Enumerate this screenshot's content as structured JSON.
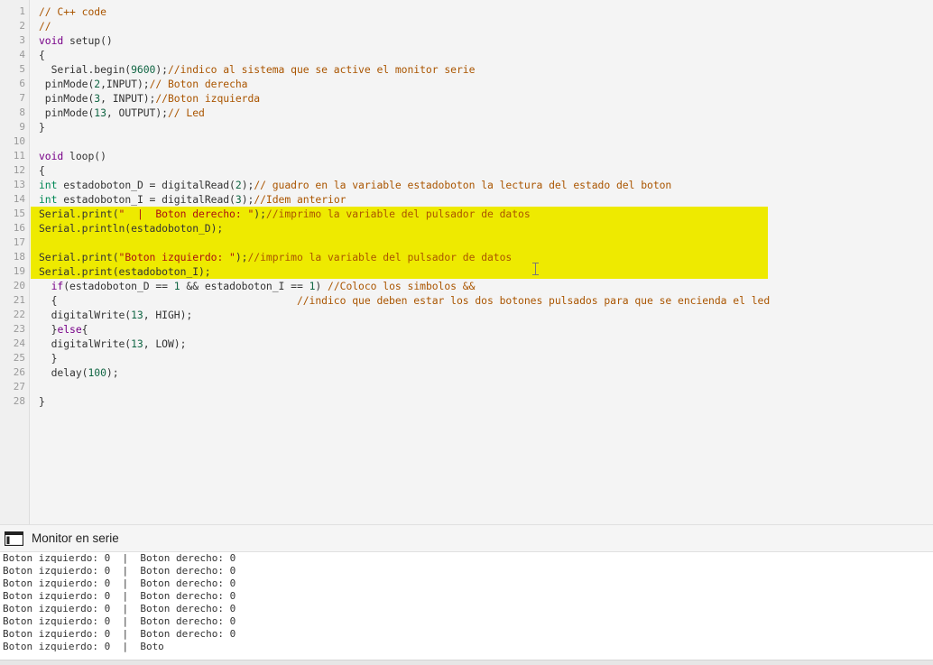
{
  "editor": {
    "highlight_color": "#eeea00",
    "lines": [
      {
        "n": "1",
        "hl": false,
        "tokens": [
          {
            "c": "comment",
            "t": "// C++ code"
          }
        ]
      },
      {
        "n": "2",
        "hl": false,
        "tokens": [
          {
            "c": "comment",
            "t": "//"
          }
        ]
      },
      {
        "n": "3",
        "hl": false,
        "tokens": [
          {
            "c": "kw",
            "t": "void"
          },
          {
            "c": "plain",
            "t": " setup()"
          }
        ]
      },
      {
        "n": "4",
        "hl": false,
        "tokens": [
          {
            "c": "plain",
            "t": "{"
          }
        ]
      },
      {
        "n": "5",
        "hl": false,
        "tokens": [
          {
            "c": "plain",
            "t": "  Serial.begin("
          },
          {
            "c": "num",
            "t": "9600"
          },
          {
            "c": "plain",
            "t": ");"
          },
          {
            "c": "comment",
            "t": "//indico al sistema que se active el monitor serie"
          }
        ]
      },
      {
        "n": "6",
        "hl": false,
        "tokens": [
          {
            "c": "plain",
            "t": " pinMode("
          },
          {
            "c": "num",
            "t": "2"
          },
          {
            "c": "plain",
            "t": ",INPUT);"
          },
          {
            "c": "comment",
            "t": "// Boton derecha"
          }
        ]
      },
      {
        "n": "7",
        "hl": false,
        "tokens": [
          {
            "c": "plain",
            "t": " pinMode("
          },
          {
            "c": "num",
            "t": "3"
          },
          {
            "c": "plain",
            "t": ", INPUT);"
          },
          {
            "c": "comment",
            "t": "//Boton izquierda"
          }
        ]
      },
      {
        "n": "8",
        "hl": false,
        "tokens": [
          {
            "c": "plain",
            "t": " pinMode("
          },
          {
            "c": "num",
            "t": "13"
          },
          {
            "c": "plain",
            "t": ", OUTPUT);"
          },
          {
            "c": "comment",
            "t": "// Led"
          }
        ]
      },
      {
        "n": "9",
        "hl": false,
        "tokens": [
          {
            "c": "plain",
            "t": "}"
          }
        ]
      },
      {
        "n": "10",
        "hl": false,
        "tokens": []
      },
      {
        "n": "11",
        "hl": false,
        "tokens": [
          {
            "c": "kw",
            "t": "void"
          },
          {
            "c": "plain",
            "t": " loop()"
          }
        ]
      },
      {
        "n": "12",
        "hl": false,
        "tokens": [
          {
            "c": "plain",
            "t": "{"
          }
        ]
      },
      {
        "n": "13",
        "hl": false,
        "tokens": [
          {
            "c": "type",
            "t": "int"
          },
          {
            "c": "plain",
            "t": " estadoboton_D = digitalRead("
          },
          {
            "c": "num",
            "t": "2"
          },
          {
            "c": "plain",
            "t": ");"
          },
          {
            "c": "comment",
            "t": "// guadro en la variable estadoboton la lectura del estado del boton"
          }
        ]
      },
      {
        "n": "14",
        "hl": false,
        "tokens": [
          {
            "c": "type",
            "t": "int"
          },
          {
            "c": "plain",
            "t": " estadoboton_I = digitalRead("
          },
          {
            "c": "num",
            "t": "3"
          },
          {
            "c": "plain",
            "t": ");"
          },
          {
            "c": "comment",
            "t": "//Idem anterior"
          }
        ]
      },
      {
        "n": "15",
        "hl": true,
        "tokens": [
          {
            "c": "plain",
            "t": "Serial.print("
          },
          {
            "c": "str",
            "t": "\"  |  Boton derecho: \""
          },
          {
            "c": "plain",
            "t": ");"
          },
          {
            "c": "comment",
            "t": "//imprimo la variable del pulsador de datos"
          }
        ]
      },
      {
        "n": "16",
        "hl": true,
        "tokens": [
          {
            "c": "plain",
            "t": "Serial.println(estadoboton_D);"
          }
        ]
      },
      {
        "n": "17",
        "hl": true,
        "tokens": []
      },
      {
        "n": "18",
        "hl": true,
        "tokens": [
          {
            "c": "plain",
            "t": "Serial.print("
          },
          {
            "c": "str",
            "t": "\"Boton izquierdo: \""
          },
          {
            "c": "plain",
            "t": ");"
          },
          {
            "c": "comment",
            "t": "//imprimo la variable del pulsador de datos"
          }
        ]
      },
      {
        "n": "19",
        "hl": true,
        "tokens": [
          {
            "c": "plain",
            "t": "Serial.print(estadoboton_I);"
          }
        ]
      },
      {
        "n": "20",
        "hl": false,
        "tokens": [
          {
            "c": "plain",
            "t": "  "
          },
          {
            "c": "kw",
            "t": "if"
          },
          {
            "c": "plain",
            "t": "(estadoboton_D == "
          },
          {
            "c": "num",
            "t": "1"
          },
          {
            "c": "plain",
            "t": " && estadoboton_I == "
          },
          {
            "c": "num",
            "t": "1"
          },
          {
            "c": "plain",
            "t": ") "
          },
          {
            "c": "comment",
            "t": "//Coloco los simbolos &&"
          }
        ]
      },
      {
        "n": "21",
        "hl": false,
        "tokens": [
          {
            "c": "plain",
            "t": "  {                                       "
          },
          {
            "c": "comment",
            "t": "//indico que deben estar los dos botones pulsados para que se encienda el led"
          }
        ]
      },
      {
        "n": "22",
        "hl": false,
        "tokens": [
          {
            "c": "plain",
            "t": "  digitalWrite("
          },
          {
            "c": "num",
            "t": "13"
          },
          {
            "c": "plain",
            "t": ", HIGH);"
          }
        ]
      },
      {
        "n": "23",
        "hl": false,
        "tokens": [
          {
            "c": "plain",
            "t": "  }"
          },
          {
            "c": "kw",
            "t": "else"
          },
          {
            "c": "plain",
            "t": "{"
          }
        ]
      },
      {
        "n": "24",
        "hl": false,
        "tokens": [
          {
            "c": "plain",
            "t": "  digitalWrite("
          },
          {
            "c": "num",
            "t": "13"
          },
          {
            "c": "plain",
            "t": ", LOW);"
          }
        ]
      },
      {
        "n": "25",
        "hl": false,
        "tokens": [
          {
            "c": "plain",
            "t": "  }"
          }
        ]
      },
      {
        "n": "26",
        "hl": false,
        "tokens": [
          {
            "c": "plain",
            "t": "  delay("
          },
          {
            "c": "num",
            "t": "100"
          },
          {
            "c": "plain",
            "t": ");"
          }
        ]
      },
      {
        "n": "27",
        "hl": false,
        "tokens": []
      },
      {
        "n": "28",
        "hl": false,
        "tokens": [
          {
            "c": "plain",
            "t": "}"
          }
        ]
      }
    ]
  },
  "monitor": {
    "icon": "serial-monitor-icon",
    "title": "Monitor en serie",
    "output": [
      "Boton izquierdo: 0  |  Boton derecho: 0",
      "Boton izquierdo: 0  |  Boton derecho: 0",
      "Boton izquierdo: 0  |  Boton derecho: 0",
      "Boton izquierdo: 0  |  Boton derecho: 0",
      "Boton izquierdo: 0  |  Boton derecho: 0",
      "Boton izquierdo: 0  |  Boton derecho: 0",
      "Boton izquierdo: 0  |  Boton derecho: 0",
      "Boton izquierdo: 0  |  Boto"
    ]
  }
}
